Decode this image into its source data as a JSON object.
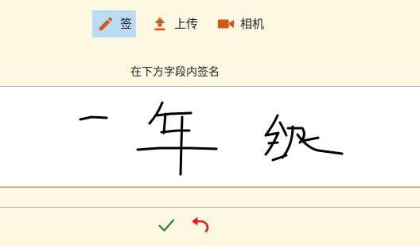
{
  "toolbar": {
    "sign": {
      "label": "签",
      "icon": "pencil-icon",
      "active": true
    },
    "upload": {
      "label": "上传",
      "icon": "upload-icon"
    },
    "camera": {
      "label": "相机",
      "icon": "video-camera-icon"
    }
  },
  "prompt": "在下方字段内签名",
  "signature": {
    "text": "一年级"
  },
  "actions": {
    "confirm": {
      "icon": "checkmark-icon"
    },
    "undo": {
      "icon": "undo-icon"
    }
  },
  "colors": {
    "background": "#fdf8e1",
    "active_tool": "#b8dcf4",
    "icon_orange": "#d2581e",
    "accent_line": "#e3ae86",
    "confirm_green": "#1e8a2a",
    "undo_red": "#e01b1b"
  }
}
